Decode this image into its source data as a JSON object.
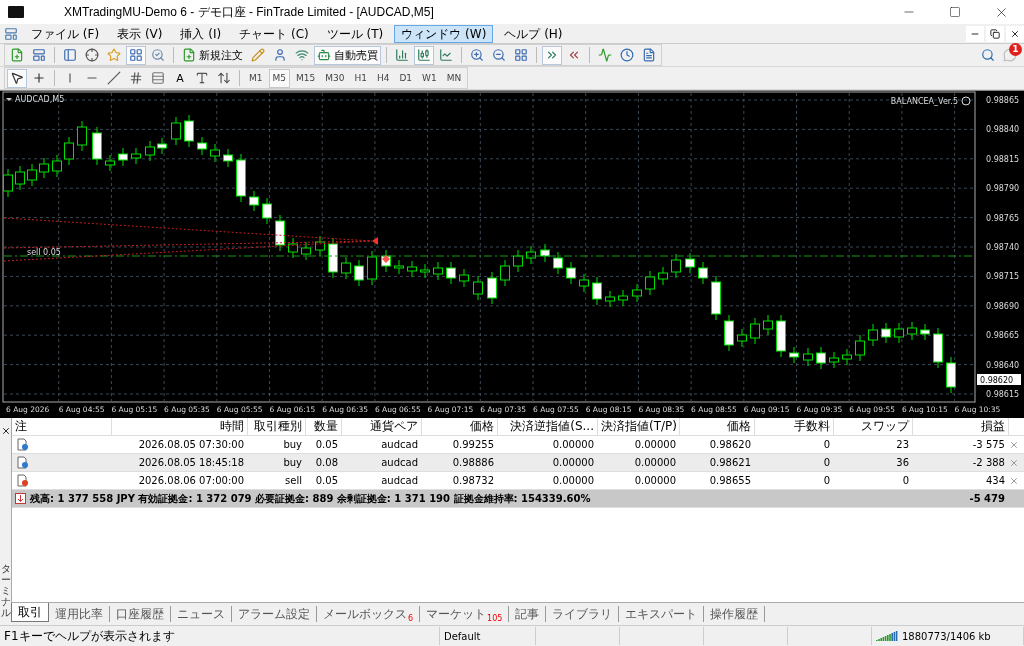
{
  "window": {
    "title": "XMTradingMU-Demo 6 - デモ口座 - FinTrade Limited - [AUDCAD,M5]"
  },
  "menu": [
    {
      "label": "ファイル (F)",
      "selected": false
    },
    {
      "label": "表示 (V)",
      "selected": false
    },
    {
      "label": "挿入 (I)",
      "selected": false
    },
    {
      "label": "チャート (C)",
      "selected": false
    },
    {
      "label": "ツール (T)",
      "selected": false
    },
    {
      "label": "ウィンドウ (W)",
      "selected": true
    },
    {
      "label": "ヘルプ (H)",
      "selected": false
    }
  ],
  "toolbar": {
    "buttons": [
      {
        "label": "新規注文",
        "pressed": false
      },
      {
        "label": "自動売買",
        "pressed": true
      }
    ],
    "chart_modes": [
      {
        "selected": false
      },
      {
        "selected": true
      },
      {
        "selected": false
      }
    ],
    "notifications": "1"
  },
  "drawing_tools": {
    "pointers": [
      {
        "selected": true
      },
      {
        "selected": false
      }
    ],
    "text_tool": "A",
    "timeframes": [
      {
        "label": "M1",
        "selected": false
      },
      {
        "label": "M5",
        "selected": true
      },
      {
        "label": "M15",
        "selected": false
      },
      {
        "label": "M30",
        "selected": false
      },
      {
        "label": "H1",
        "selected": false
      },
      {
        "label": "H4",
        "selected": false
      },
      {
        "label": "D1",
        "selected": false
      },
      {
        "label": "W1",
        "selected": false
      },
      {
        "label": "MN",
        "selected": false
      }
    ]
  },
  "chart": {
    "title": "AUDCAD,M5",
    "expert": "BALANCEA_Ver.5",
    "order_label": "sell 0.05",
    "current_price": "0.98620",
    "price_labels": [
      "0.98865",
      "0.98840",
      "0.98815",
      "0.98790",
      "0.98765",
      "0.98740",
      "0.98715",
      "0.98690",
      "0.98665",
      "0.98640",
      "0.98615"
    ],
    "time_labels": [
      "6 Aug 2026",
      "6 Aug 04:55",
      "6 Aug 05:15",
      "6 Aug 05:35",
      "6 Aug 05:55",
      "6 Aug 06:15",
      "6 Aug 06:35",
      "6 Aug 06:55",
      "6 Aug 07:15",
      "6 Aug 07:35",
      "6 Aug 07:55",
      "6 Aug 08:15",
      "6 Aug 08:35",
      "6 Aug 08:55",
      "6 Aug 09:15",
      "6 Aug 09:35",
      "6 Aug 09:55",
      "6 Aug 10:15",
      "6 Aug 10:35"
    ]
  },
  "terminal": {
    "side_label": "ターミナル",
    "columns": [
      "注",
      "時間",
      "取引種別",
      "数量",
      "通貨ペア",
      "価格",
      "決済逆指値(S...",
      "決済指値(T/P)",
      "価格",
      "手数料",
      "スワップ",
      "損益"
    ],
    "orders": [
      {
        "kind": "buy",
        "time": "2026.08.05 07:30:00",
        "type": "buy",
        "volume": "0.05",
        "symbol": "audcad",
        "open_price": "0.99255",
        "sl": "0.00000",
        "tp": "0.00000",
        "price": "0.98620",
        "commission": "0",
        "swap": "23",
        "profit": "-3 575"
      },
      {
        "kind": "buy",
        "time": "2026.08.05 18:45:18",
        "type": "buy",
        "volume": "0.08",
        "symbol": "audcad",
        "open_price": "0.98886",
        "sl": "0.00000",
        "tp": "0.00000",
        "price": "0.98621",
        "commission": "0",
        "swap": "36",
        "profit": "-2 388"
      },
      {
        "kind": "sell",
        "time": "2026.08.06 07:00:00",
        "type": "sell",
        "volume": "0.05",
        "symbol": "audcad",
        "open_price": "0.98732",
        "sl": "0.00000",
        "tp": "0.00000",
        "price": "0.98655",
        "commission": "0",
        "swap": "0",
        "profit": "434"
      }
    ],
    "summary": {
      "text": "残高: 1 377 558 JPY  有効証拠金: 1 372 079  必要証拠金: 889  余剰証拠金: 1 371 190  証拠金維持率: 154339.60%",
      "profit": "-5 479"
    },
    "tabs": [
      {
        "label": "取引",
        "selected": true
      },
      {
        "label": "運用比率",
        "selected": false
      },
      {
        "label": "口座履歴",
        "selected": false
      },
      {
        "label": "ニュース",
        "selected": false
      },
      {
        "label": "アラーム設定",
        "selected": false
      },
      {
        "label": "メールボックス",
        "count": "6",
        "selected": false
      },
      {
        "label": "マーケット",
        "count": "105",
        "selected": false
      },
      {
        "label": "記事",
        "selected": false
      },
      {
        "label": "ライブラリ",
        "selected": false
      },
      {
        "label": "エキスパート",
        "selected": false
      },
      {
        "label": "操作履歴",
        "selected": false
      }
    ]
  },
  "status_bar": {
    "help": "F1キーでヘルプが表示されます",
    "profile": "Default",
    "traffic": "1880773/1406 kb"
  }
}
